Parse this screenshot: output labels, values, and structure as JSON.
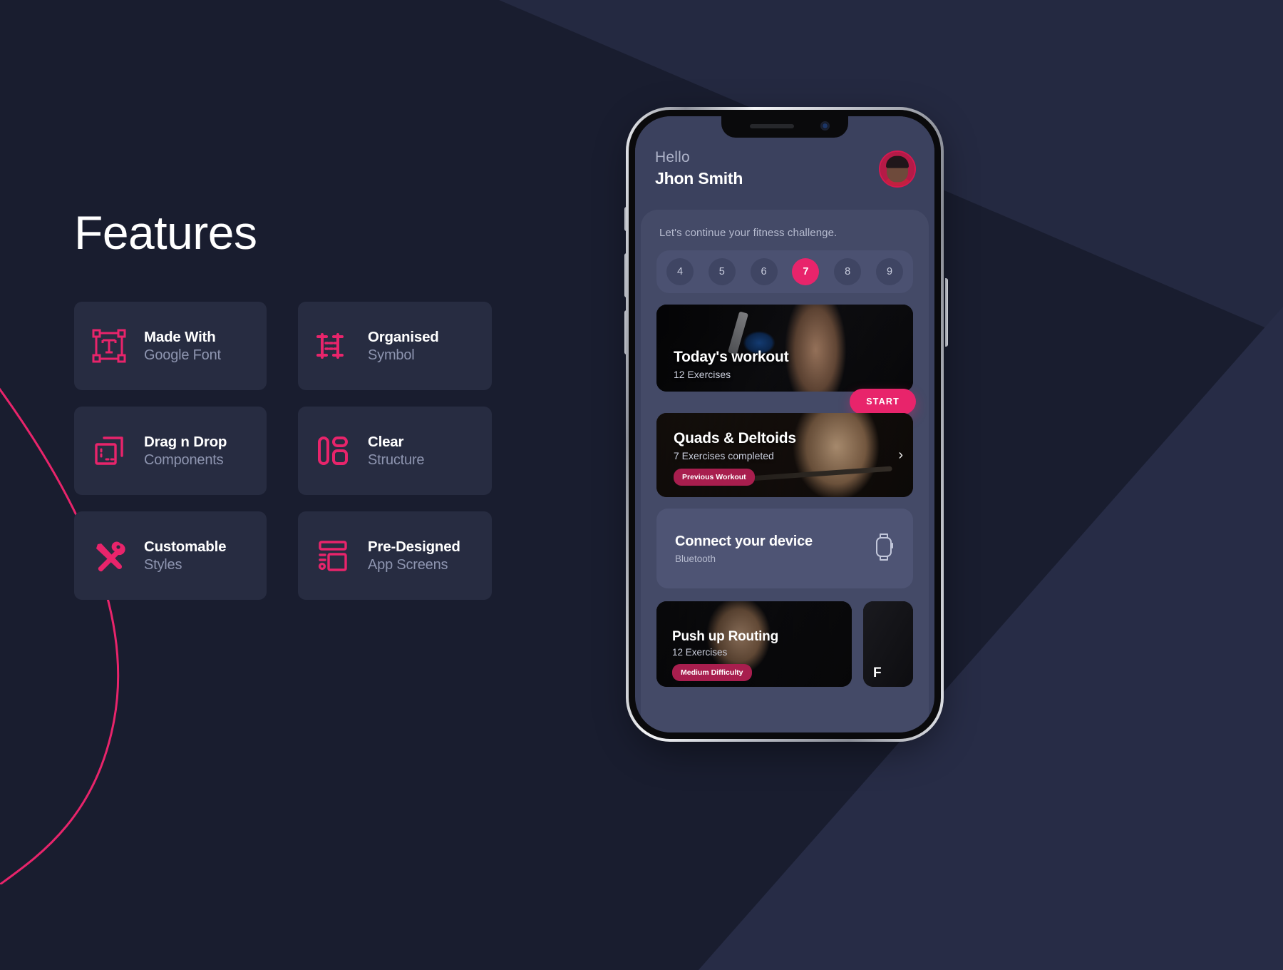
{
  "theme": {
    "bg": "#191d2f",
    "bg_wedge_top": "#242941",
    "bg_wedge_right": "#272c46",
    "card_bg": "#272c41",
    "accent": "#e8246b",
    "accent_dark": "#a81e4e",
    "text_primary": "#ffffff",
    "text_muted": "#8e95b0",
    "screen_bg": "#3b415e",
    "panel_bg": "#444a67"
  },
  "left": {
    "title": "Features",
    "features": [
      {
        "icon": "text-frame-icon",
        "title": "Made With",
        "subtitle": "Google Font"
      },
      {
        "icon": "symbol-nodes-icon",
        "title": "Organised",
        "subtitle": "Symbol"
      },
      {
        "icon": "drag-drop-icon",
        "title": "Drag n Drop",
        "subtitle": "Components"
      },
      {
        "icon": "layout-blocks-icon",
        "title": "Clear",
        "subtitle": "Structure"
      },
      {
        "icon": "tools-icon",
        "title": "Customable",
        "subtitle": "Styles"
      },
      {
        "icon": "app-screen-icon",
        "title": "Pre-Designed",
        "subtitle": "App Screens"
      }
    ]
  },
  "phone": {
    "header": {
      "greeting": "Hello",
      "username": "Jhon Smith",
      "avatar_alt": "user-avatar"
    },
    "panel": {
      "challenge_text": "Let's continue your fitness challenge.",
      "days": [
        "4",
        "5",
        "6",
        "7",
        "8",
        "9"
      ],
      "active_day": "7"
    },
    "today_card": {
      "title": "Today's workout",
      "subtitle": "12 Exercises",
      "cta": "START"
    },
    "previous_card": {
      "title": "Quads & Deltoids",
      "subtitle": "7 Exercises completed",
      "tag": "Previous Workout",
      "chevron": "›"
    },
    "device_card": {
      "title": "Connect your device",
      "subtitle": "Bluetooth",
      "icon": "smartwatch-icon"
    },
    "bottom_cards": [
      {
        "title": "Push up Routing",
        "subtitle": "12 Exercises",
        "tag": "Medium Difficulty"
      },
      {
        "title": "F",
        "subtitle": "",
        "tag": ""
      }
    ]
  }
}
